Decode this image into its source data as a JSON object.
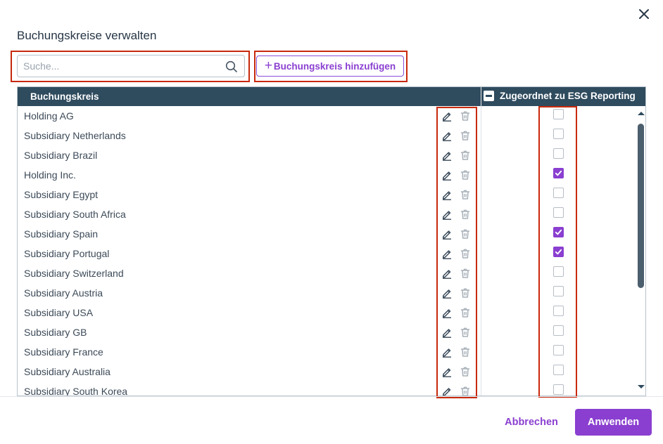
{
  "dialog": {
    "title": "Buchungskreise verwalten",
    "close_icon": "close-icon"
  },
  "toolbar": {
    "search_placeholder": "Suche...",
    "search_value": "",
    "search_icon": "search-icon",
    "add_plus": "+",
    "add_label": "Buchungskreis hinzufügen"
  },
  "table": {
    "col_name": "Buchungskreis",
    "col_assigned": "Zugeordnet zu ESG Reporting",
    "header_toggle_icon": "minus-square-icon",
    "row_edit_icon": "pencil-icon",
    "row_delete_icon": "trash-icon",
    "rows": [
      {
        "name": "Holding AG",
        "assigned": false
      },
      {
        "name": "Subsidiary Netherlands",
        "assigned": false
      },
      {
        "name": "Subsidiary Brazil",
        "assigned": false
      },
      {
        "name": "Holding Inc.",
        "assigned": true
      },
      {
        "name": "Subsidiary Egypt",
        "assigned": false
      },
      {
        "name": "Subsidiary South Africa",
        "assigned": false
      },
      {
        "name": "Subsidiary Spain",
        "assigned": true
      },
      {
        "name": "Subsidiary Portugal",
        "assigned": true
      },
      {
        "name": "Subsidiary Switzerland",
        "assigned": false
      },
      {
        "name": "Subsidiary Austria",
        "assigned": false
      },
      {
        "name": "Subsidiary USA",
        "assigned": false
      },
      {
        "name": "Subsidiary GB",
        "assigned": false
      },
      {
        "name": "Subsidiary France",
        "assigned": false
      },
      {
        "name": "Subsidiary Australia",
        "assigned": false
      },
      {
        "name": "Subsidiary South Korea",
        "assigned": false
      }
    ]
  },
  "footer": {
    "cancel_label": "Abbrechen",
    "apply_label": "Anwenden"
  },
  "colors": {
    "accent": "#8a3fd0",
    "header_bg": "#2f4b5e",
    "highlight": "#c8290c"
  }
}
